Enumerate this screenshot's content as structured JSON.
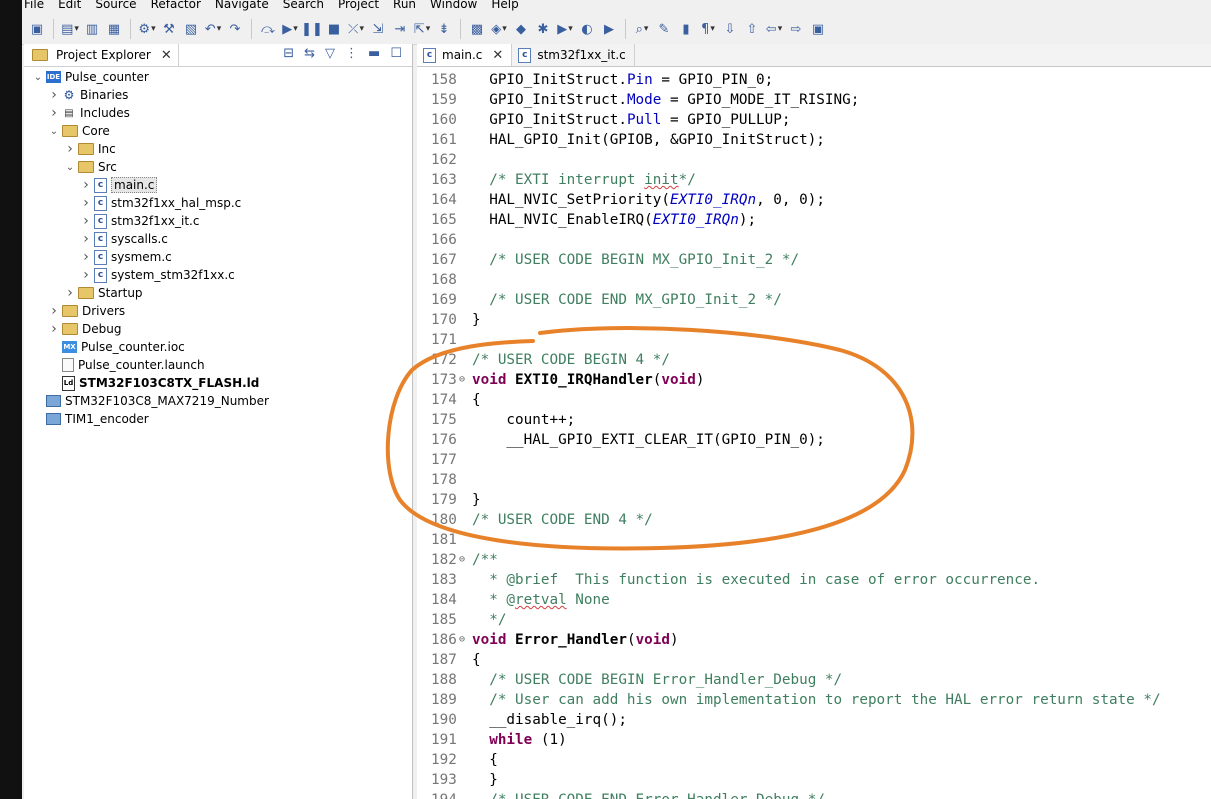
{
  "menu": [
    "File",
    "Edit",
    "Source",
    "Refactor",
    "Navigate",
    "Search",
    "Project",
    "Run",
    "Window",
    "Help"
  ],
  "toolbar_icons": [
    "ide-icon",
    "new-icon",
    "save-icon",
    "save-all-icon",
    "build-config-icon",
    "hammer-icon",
    "binary-icon",
    "undo-icon",
    "redo-icon",
    "skip-icon",
    "resume-icon",
    "suspend-icon",
    "terminate-icon",
    "disconnect-icon",
    "step-into-icon",
    "step-over-icon",
    "step-return-icon",
    "instruction-step-icon",
    "new-c-project-icon",
    "new-class-icon",
    "new-file-icon",
    "debug-icon",
    "run-icon",
    "coverage-icon",
    "external-tools-icon",
    "search-icon",
    "highlight-icon",
    "toggle-mark-icon",
    "show-whitespace-icon",
    "next-annotation-icon",
    "previous-annotation-icon",
    "back-icon",
    "forward-icon",
    "perspective-icon"
  ],
  "explorer": {
    "title": "Project Explorer",
    "tree": [
      {
        "label": "Pulse_counter",
        "depth": 0,
        "twisty": "expanded",
        "icon": "proj"
      },
      {
        "label": "Binaries",
        "depth": 1,
        "twisty": "collapsed",
        "icon": "bin"
      },
      {
        "label": "Includes",
        "depth": 1,
        "twisty": "collapsed",
        "icon": "inc"
      },
      {
        "label": "Core",
        "depth": 1,
        "twisty": "expanded",
        "icon": "folder"
      },
      {
        "label": "Inc",
        "depth": 2,
        "twisty": "collapsed",
        "icon": "folder"
      },
      {
        "label": "Src",
        "depth": 2,
        "twisty": "expanded",
        "icon": "folder"
      },
      {
        "label": "main.c",
        "depth": 3,
        "twisty": "collapsed",
        "icon": "cfile",
        "selected": true
      },
      {
        "label": "stm32f1xx_hal_msp.c",
        "depth": 3,
        "twisty": "collapsed",
        "icon": "cfile"
      },
      {
        "label": "stm32f1xx_it.c",
        "depth": 3,
        "twisty": "collapsed",
        "icon": "cfile"
      },
      {
        "label": "syscalls.c",
        "depth": 3,
        "twisty": "collapsed",
        "icon": "cfile"
      },
      {
        "label": "sysmem.c",
        "depth": 3,
        "twisty": "collapsed",
        "icon": "cfile"
      },
      {
        "label": "system_stm32f1xx.c",
        "depth": 3,
        "twisty": "collapsed",
        "icon": "cfile"
      },
      {
        "label": "Startup",
        "depth": 2,
        "twisty": "collapsed",
        "icon": "folder"
      },
      {
        "label": "Drivers",
        "depth": 1,
        "twisty": "collapsed",
        "icon": "folder"
      },
      {
        "label": "Debug",
        "depth": 1,
        "twisty": "collapsed",
        "icon": "folder"
      },
      {
        "label": "Pulse_counter.ioc",
        "depth": 1,
        "twisty": "none",
        "icon": "mx"
      },
      {
        "label": "Pulse_counter.launch",
        "depth": 1,
        "twisty": "none",
        "icon": "launch"
      },
      {
        "label": "STM32F103C8TX_FLASH.ld",
        "depth": 1,
        "twisty": "none",
        "icon": "ld",
        "bold": true
      },
      {
        "label": "STM32F103C8_MAX7219_Number",
        "depth": 0,
        "twisty": "none",
        "icon": "closedproj"
      },
      {
        "label": "TIM1_encoder",
        "depth": 0,
        "twisty": "none",
        "icon": "closedproj"
      }
    ]
  },
  "editor": {
    "tabs": [
      {
        "label": "main.c",
        "active": true
      },
      {
        "label": "stm32f1xx_it.c",
        "active": false
      }
    ],
    "lines": [
      {
        "n": "158",
        "fold": "",
        "segs": [
          [
            "t",
            "  GPIO_InitStruct."
          ],
          [
            "f",
            "Pin"
          ],
          [
            "t",
            " = GPIO_PIN_0;"
          ]
        ]
      },
      {
        "n": "159",
        "fold": "",
        "segs": [
          [
            "t",
            "  GPIO_InitStruct."
          ],
          [
            "f",
            "Mode"
          ],
          [
            "t",
            " = GPIO_MODE_IT_RISING;"
          ]
        ]
      },
      {
        "n": "160",
        "fold": "",
        "segs": [
          [
            "t",
            "  GPIO_InitStruct."
          ],
          [
            "f",
            "Pull"
          ],
          [
            "t",
            " = GPIO_PULLUP;"
          ]
        ]
      },
      {
        "n": "161",
        "fold": "",
        "segs": [
          [
            "t",
            "  HAL_GPIO_Init(GPIOB, &GPIO_InitStruct);"
          ]
        ]
      },
      {
        "n": "162",
        "fold": "",
        "segs": []
      },
      {
        "n": "163",
        "fold": "",
        "segs": [
          [
            "c",
            "  /* EXTI interrupt "
          ],
          [
            "cs",
            "init"
          ],
          [
            "c",
            "*/"
          ]
        ]
      },
      {
        "n": "164",
        "fold": "",
        "segs": [
          [
            "t",
            "  HAL_NVIC_SetPriority("
          ],
          [
            "m",
            "EXTI0_IRQn"
          ],
          [
            "t",
            ", 0, 0);"
          ]
        ]
      },
      {
        "n": "165",
        "fold": "",
        "segs": [
          [
            "t",
            "  HAL_NVIC_EnableIRQ("
          ],
          [
            "m",
            "EXTI0_IRQn"
          ],
          [
            "t",
            ");"
          ]
        ]
      },
      {
        "n": "166",
        "fold": "",
        "segs": []
      },
      {
        "n": "167",
        "fold": "",
        "segs": [
          [
            "c",
            "  /* USER CODE BEGIN MX_GPIO_Init_2 */"
          ]
        ]
      },
      {
        "n": "168",
        "fold": "",
        "segs": []
      },
      {
        "n": "169",
        "fold": "",
        "segs": [
          [
            "c",
            "  /* USER CODE END MX_GPIO_Init_2 */"
          ]
        ]
      },
      {
        "n": "170",
        "fold": "",
        "segs": [
          [
            "t",
            "}"
          ]
        ]
      },
      {
        "n": "171",
        "fold": "",
        "segs": []
      },
      {
        "n": "172",
        "fold": "",
        "segs": [
          [
            "c",
            "/* USER CODE BEGIN 4 */"
          ]
        ]
      },
      {
        "n": "173",
        "fold": "⊖",
        "segs": [
          [
            "k",
            "void"
          ],
          [
            "t",
            " "
          ],
          [
            "b",
            "EXTI0_IRQHandler"
          ],
          [
            "t",
            "("
          ],
          [
            "k",
            "void"
          ],
          [
            "t",
            ")"
          ]
        ]
      },
      {
        "n": "174",
        "fold": "",
        "segs": [
          [
            "t",
            "{"
          ]
        ]
      },
      {
        "n": "175",
        "fold": "",
        "segs": [
          [
            "t",
            "    count++;"
          ]
        ]
      },
      {
        "n": "176",
        "fold": "",
        "segs": [
          [
            "t",
            "    __HAL_GPIO_EXTI_CLEAR_IT(GPIO_PIN_0);"
          ]
        ]
      },
      {
        "n": "177",
        "fold": "",
        "segs": []
      },
      {
        "n": "178",
        "fold": "",
        "segs": []
      },
      {
        "n": "179",
        "fold": "",
        "segs": [
          [
            "t",
            "}"
          ]
        ]
      },
      {
        "n": "180",
        "fold": "",
        "segs": [
          [
            "c",
            "/* USER CODE END 4 */"
          ]
        ]
      },
      {
        "n": "181",
        "fold": "",
        "segs": []
      },
      {
        "n": "182",
        "fold": "⊖",
        "segs": [
          [
            "c",
            "/**"
          ]
        ]
      },
      {
        "n": "183",
        "fold": "",
        "segs": [
          [
            "c",
            "  * @brief  This function is executed in case of error occurrence."
          ]
        ]
      },
      {
        "n": "184",
        "fold": "",
        "segs": [
          [
            "c",
            "  * @"
          ],
          [
            "cs",
            "retval"
          ],
          [
            "c",
            " None"
          ]
        ]
      },
      {
        "n": "185",
        "fold": "",
        "segs": [
          [
            "c",
            "  */"
          ]
        ]
      },
      {
        "n": "186",
        "fold": "⊖",
        "segs": [
          [
            "k",
            "void"
          ],
          [
            "t",
            " "
          ],
          [
            "b",
            "Error_Handler"
          ],
          [
            "t",
            "("
          ],
          [
            "k",
            "void"
          ],
          [
            "t",
            ")"
          ]
        ]
      },
      {
        "n": "187",
        "fold": "",
        "segs": [
          [
            "t",
            "{"
          ]
        ]
      },
      {
        "n": "188",
        "fold": "",
        "segs": [
          [
            "c",
            "  /* USER CODE BEGIN Error_Handler_Debug */"
          ]
        ]
      },
      {
        "n": "189",
        "fold": "",
        "segs": [
          [
            "c",
            "  /* User can add his own implementation to report the HAL error return state */"
          ]
        ]
      },
      {
        "n": "190",
        "fold": "",
        "segs": [
          [
            "t",
            "  __disable_irq();"
          ]
        ]
      },
      {
        "n": "191",
        "fold": "",
        "segs": [
          [
            "t",
            "  "
          ],
          [
            "k",
            "while"
          ],
          [
            "t",
            " (1)"
          ]
        ]
      },
      {
        "n": "192",
        "fold": "",
        "segs": [
          [
            "t",
            "  {"
          ]
        ]
      },
      {
        "n": "193",
        "fold": "",
        "segs": [
          [
            "t",
            "  }"
          ]
        ]
      },
      {
        "n": "194",
        "fold": "",
        "segs": [
          [
            "c",
            "  /* USER CODE END Error_Handler_Debug */"
          ]
        ]
      }
    ]
  },
  "annotation_color": "#e8822a"
}
